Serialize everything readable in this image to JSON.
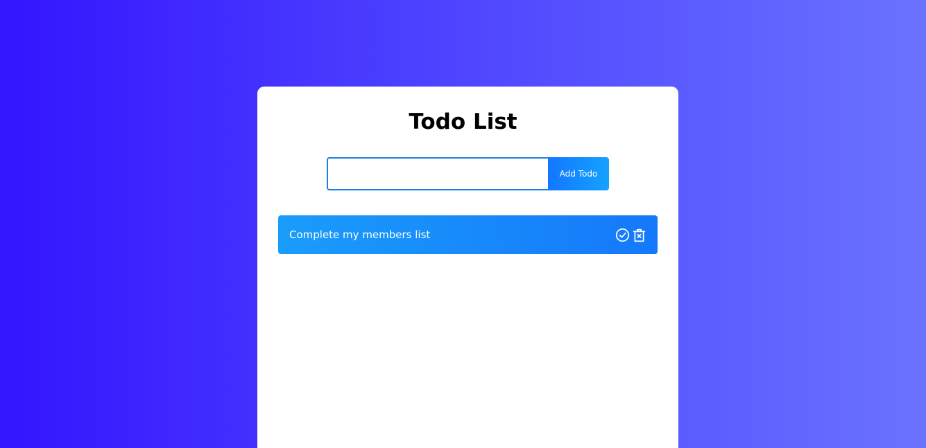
{
  "app": {
    "title": "Todo List"
  },
  "form": {
    "input_value": "",
    "input_placeholder": "",
    "add_label": "Add Todo"
  },
  "todos": [
    {
      "text": "Complete my members list",
      "icons": [
        "check-circle-icon",
        "trash-icon"
      ]
    }
  ],
  "colors": {
    "background_start": "#3315ff",
    "background_end": "#6b72ff",
    "accent": "#1578fb",
    "card": "#ffffff"
  }
}
